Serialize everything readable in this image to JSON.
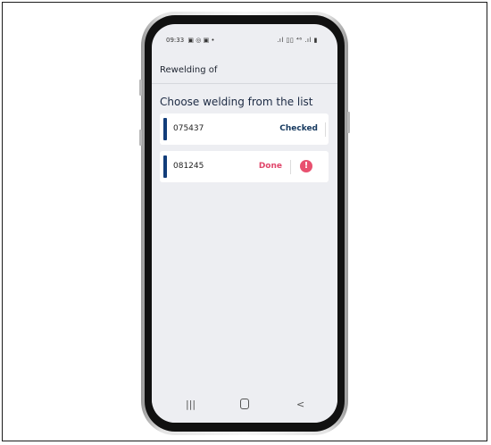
{
  "status_bar": {
    "time": "09:33",
    "left_icons": "▣ ◎ ▣ •",
    "right_icons": ".ıl ▯▯ ⁴⁶ .ıl ▮"
  },
  "app_bar": {
    "title": "Rewelding of"
  },
  "main": {
    "heading": "Choose welding from the list",
    "weldings": [
      {
        "number": "075437",
        "status": "Checked",
        "accent_color": "#123d7a",
        "status_color": "#16395f"
      },
      {
        "number": "081245",
        "status": "Done",
        "accent_color": "#123d7a",
        "status_color": "#e0456a",
        "alert": "!"
      }
    ]
  },
  "nav_bar": {
    "recents": "|||",
    "back": "<"
  },
  "colors": {
    "screen_bg": "#edeef2",
    "primary": "#123d7a",
    "alert": "#e8506f"
  }
}
